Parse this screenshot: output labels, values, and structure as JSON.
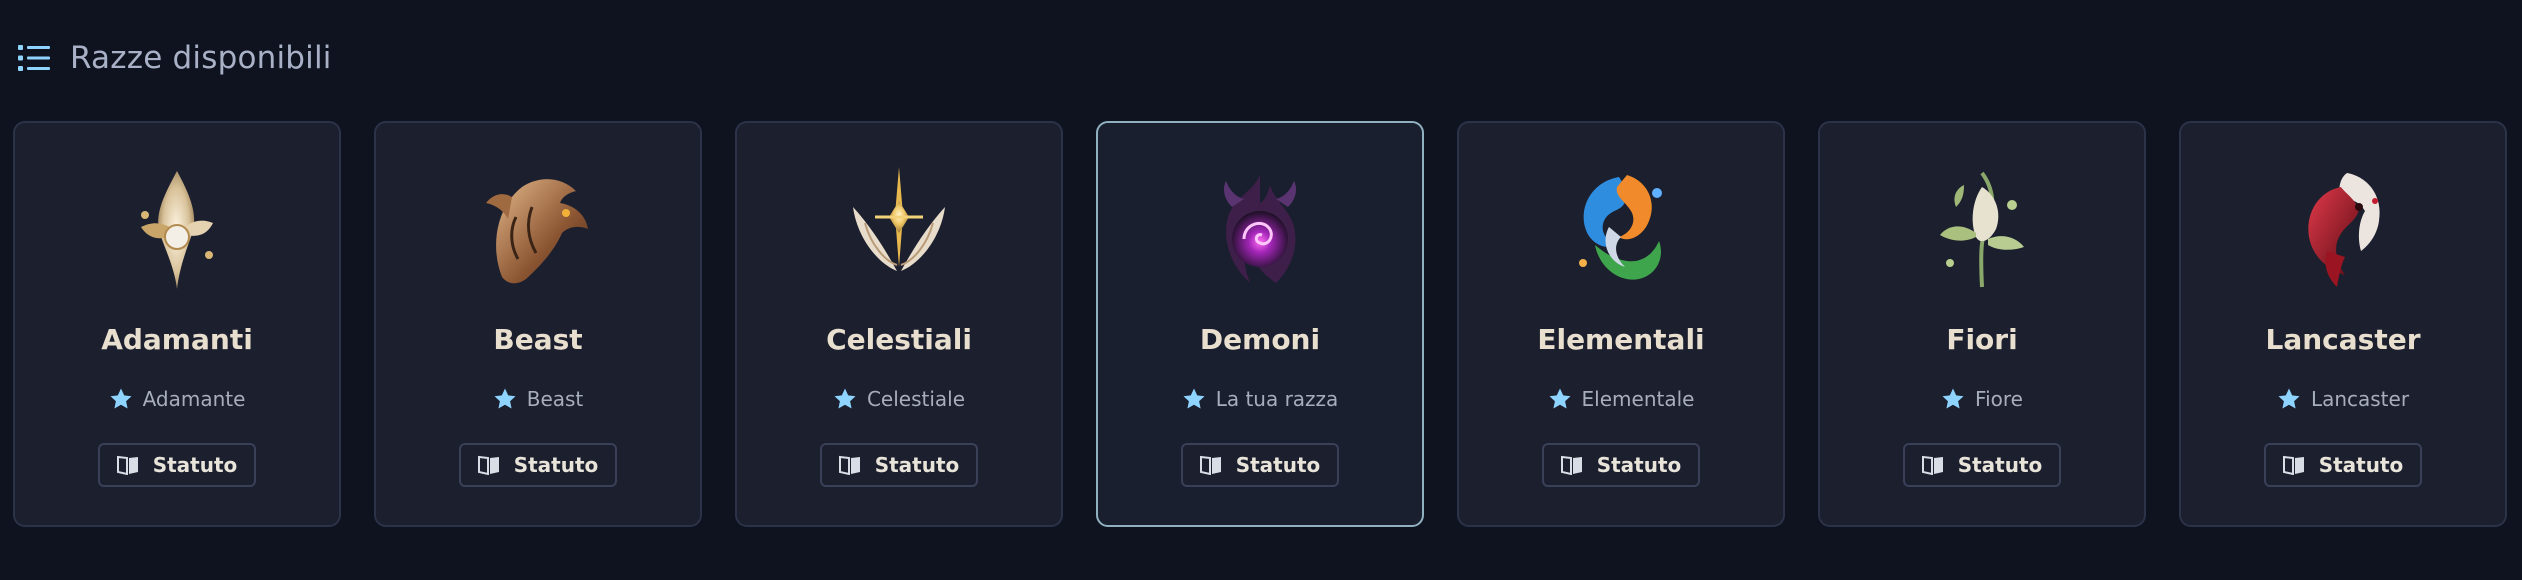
{
  "header": {
    "icon": "list-icon",
    "title": "Razze disponibili"
  },
  "colors": {
    "background": "#0f1320",
    "card_background": "#1b1f2e",
    "card_border": "#2c3247",
    "selected_border": "#8fb0bf",
    "star": "#8fd3ff"
  },
  "cards": [
    {
      "name": "Adamanti",
      "subtitle": "Adamante",
      "button_label": "Statuto",
      "emblem": "adamanti-emblem-icon",
      "selected": false
    },
    {
      "name": "Beast",
      "subtitle": "Beast",
      "button_label": "Statuto",
      "emblem": "beast-emblem-icon",
      "selected": false
    },
    {
      "name": "Celestiali",
      "subtitle": "Celestiale",
      "button_label": "Statuto",
      "emblem": "celestiali-emblem-icon",
      "selected": false
    },
    {
      "name": "Demoni",
      "subtitle": "La tua razza",
      "button_label": "Statuto",
      "emblem": "demoni-emblem-icon",
      "selected": true
    },
    {
      "name": "Elementali",
      "subtitle": "Elementale",
      "button_label": "Statuto",
      "emblem": "elementali-emblem-icon",
      "selected": false
    },
    {
      "name": "Fiori",
      "subtitle": "Fiore",
      "button_label": "Statuto",
      "emblem": "fiori-emblem-icon",
      "selected": false
    },
    {
      "name": "Lancaster",
      "subtitle": "Lancaster",
      "button_label": "Statuto",
      "emblem": "lancaster-emblem-icon",
      "selected": false
    }
  ]
}
